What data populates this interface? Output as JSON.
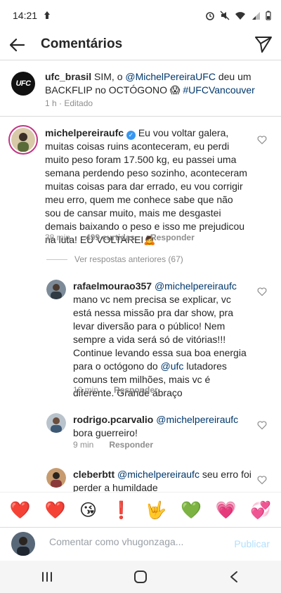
{
  "status_bar": {
    "time": "14:21"
  },
  "header": {
    "title": "Comentários"
  },
  "caption": {
    "avatar_label": "UFC",
    "username": "ufc_brasil",
    "text_1": " SIM, o ",
    "mention": "@MichelPereiraUFC",
    "text_2": " deu um BACKFLIP no OCTÓGONO 😱 ",
    "hashtag": "#UFCVancouver",
    "time": "1 h",
    "edited": " · Editado"
  },
  "main_comment": {
    "username": "michelpereiraufc",
    "text": " Eu vou voltar galera, muitas coisas ruins aconteceram, eu perdi muito peso foram 17.500 kg, eu passei uma semana perdendo peso sozinho, aconteceram muitas coisas para dar errado, eu vou corrigir meu erro, quem me conhece sabe que não sou de cansar muito, mais me desgastei demais baixando o peso e isso me prejudicou na luta! EU VOLTAREI🙇",
    "time": "38 min",
    "likes": "499 curtidas",
    "reply": "Responder"
  },
  "view_replies": "Ver respostas anteriores (67)",
  "replies": [
    {
      "username": "rafaelmourao357",
      "mention": "@michelpereiraufc",
      "text_1": " mano vc nem precisa se explicar, vc está nessa missão pra dar show, pra levar diversão para o público! Nem sempre a vida será só de vitórias!!! Continue levando essa sua boa energia para o octógono do ",
      "mention_2": "@ufc",
      "text_2": " lutadores comuns tem milhões, mais vc é diferente. Grande abraço",
      "time": "10 min",
      "reply": "Responder"
    },
    {
      "username": "rodrigo.pcarvalio",
      "mention": "@michelpereiraufc",
      "text_1": " bora guerreiro!",
      "time": "9 min",
      "reply": "Responder"
    },
    {
      "username": "cleberbtt",
      "mention": "@michelpereiraufc",
      "text_1": "  seu erro foi perder a humildade"
    }
  ],
  "emojis": [
    "❤️",
    "❤️",
    "😘",
    "❗",
    "🤟",
    "💚",
    "💗",
    "💞"
  ],
  "composer": {
    "placeholder": "Comentar como vhugonzaga...",
    "post_label": "Publicar"
  },
  "colors": {
    "mention": "#00376b",
    "verified": "#3897f0",
    "meta": "#8e8e8e",
    "post_disabled": "#b2dffc"
  }
}
